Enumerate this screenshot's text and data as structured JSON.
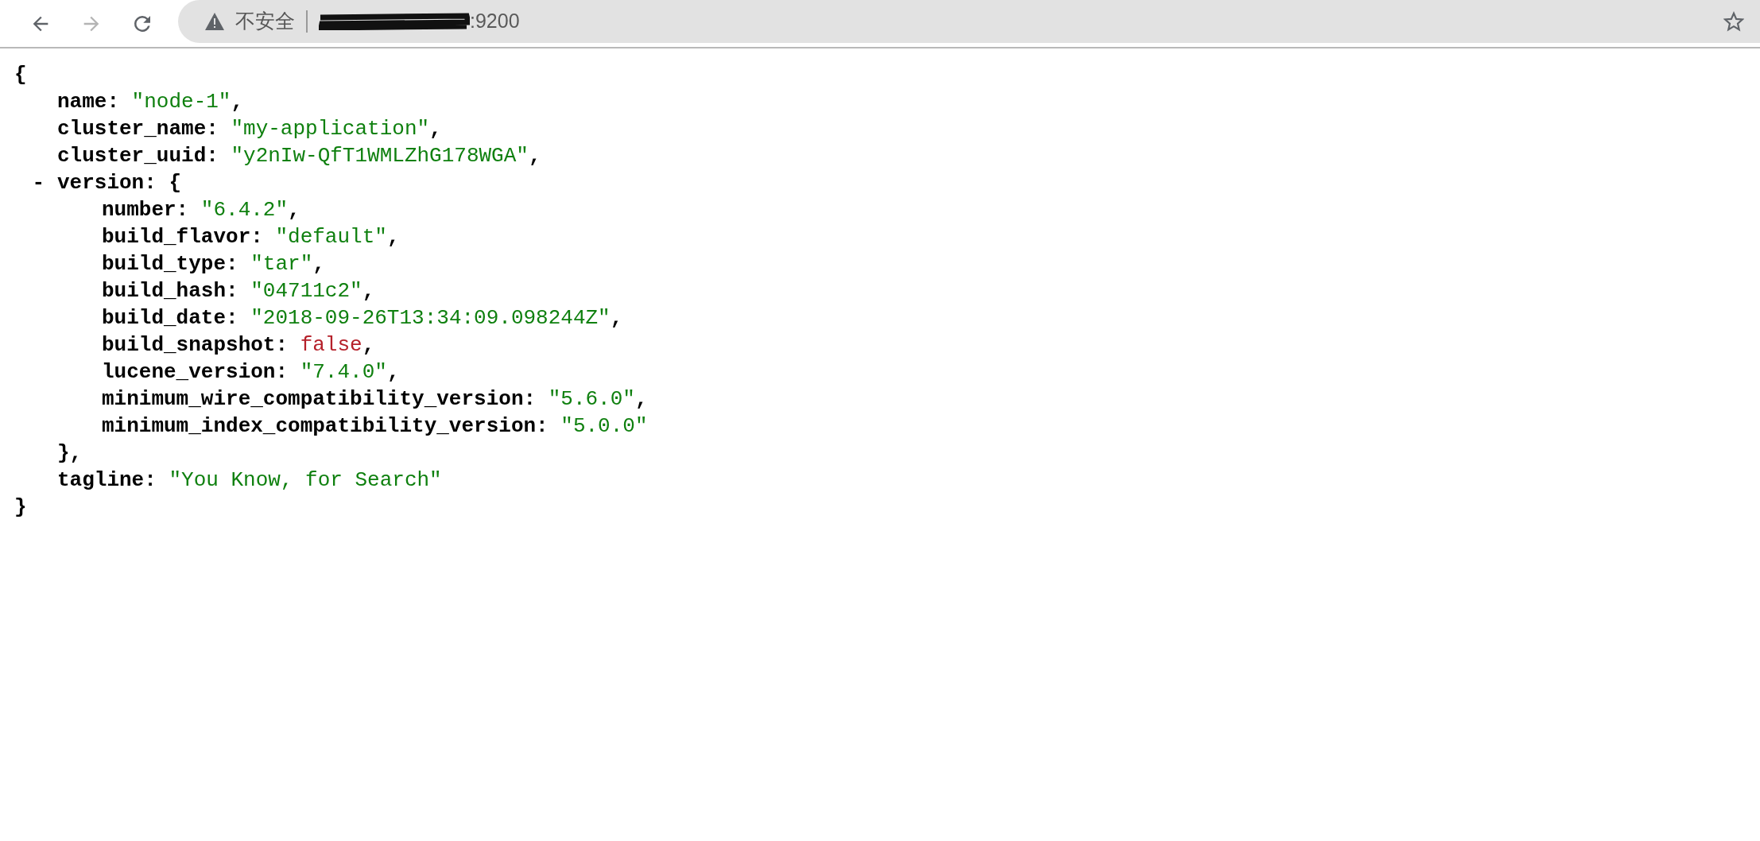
{
  "toolbar": {
    "back": {
      "disabled": false
    },
    "forward": {
      "disabled": true
    },
    "address_bar": {
      "security_label": "不安全",
      "url_visible": ":9200",
      "url_redacted": true
    }
  },
  "document": {
    "open": "{",
    "close": "}",
    "fields": [
      {
        "key": "name:",
        "value": "\"node-1\"",
        "kind": "string",
        "comma": ","
      },
      {
        "key": "cluster_name:",
        "value": "\"my-application\"",
        "kind": "string",
        "comma": ","
      },
      {
        "key": "cluster_uuid:",
        "value": "\"y2nIw-QfT1WMLZhG178WGA\"",
        "kind": "string",
        "comma": ","
      },
      {
        "key": "version:",
        "toggle": "-",
        "expanded": true,
        "open": "{",
        "close": "},",
        "children": [
          {
            "key": "number:",
            "value": "\"6.4.2\"",
            "kind": "string",
            "comma": ","
          },
          {
            "key": "build_flavor:",
            "value": "\"default\"",
            "kind": "string",
            "comma": ","
          },
          {
            "key": "build_type:",
            "value": "\"tar\"",
            "kind": "string",
            "comma": ","
          },
          {
            "key": "build_hash:",
            "value": "\"04711c2\"",
            "kind": "string",
            "comma": ","
          },
          {
            "key": "build_date:",
            "value": "\"2018-09-26T13:34:09.098244Z\"",
            "kind": "string",
            "comma": ","
          },
          {
            "key": "build_snapshot:",
            "value": "false",
            "kind": "boolean",
            "comma": ","
          },
          {
            "key": "lucene_version:",
            "value": "\"7.4.0\"",
            "kind": "string",
            "comma": ","
          },
          {
            "key": "minimum_wire_compatibility_version:",
            "value": "\"5.6.0\"",
            "kind": "string",
            "comma": ","
          },
          {
            "key": "minimum_index_compatibility_version:",
            "value": "\"5.0.0\"",
            "kind": "string"
          }
        ]
      },
      {
        "key": "tagline:",
        "value": "\"You Know, for Search\"",
        "kind": "string"
      }
    ]
  }
}
